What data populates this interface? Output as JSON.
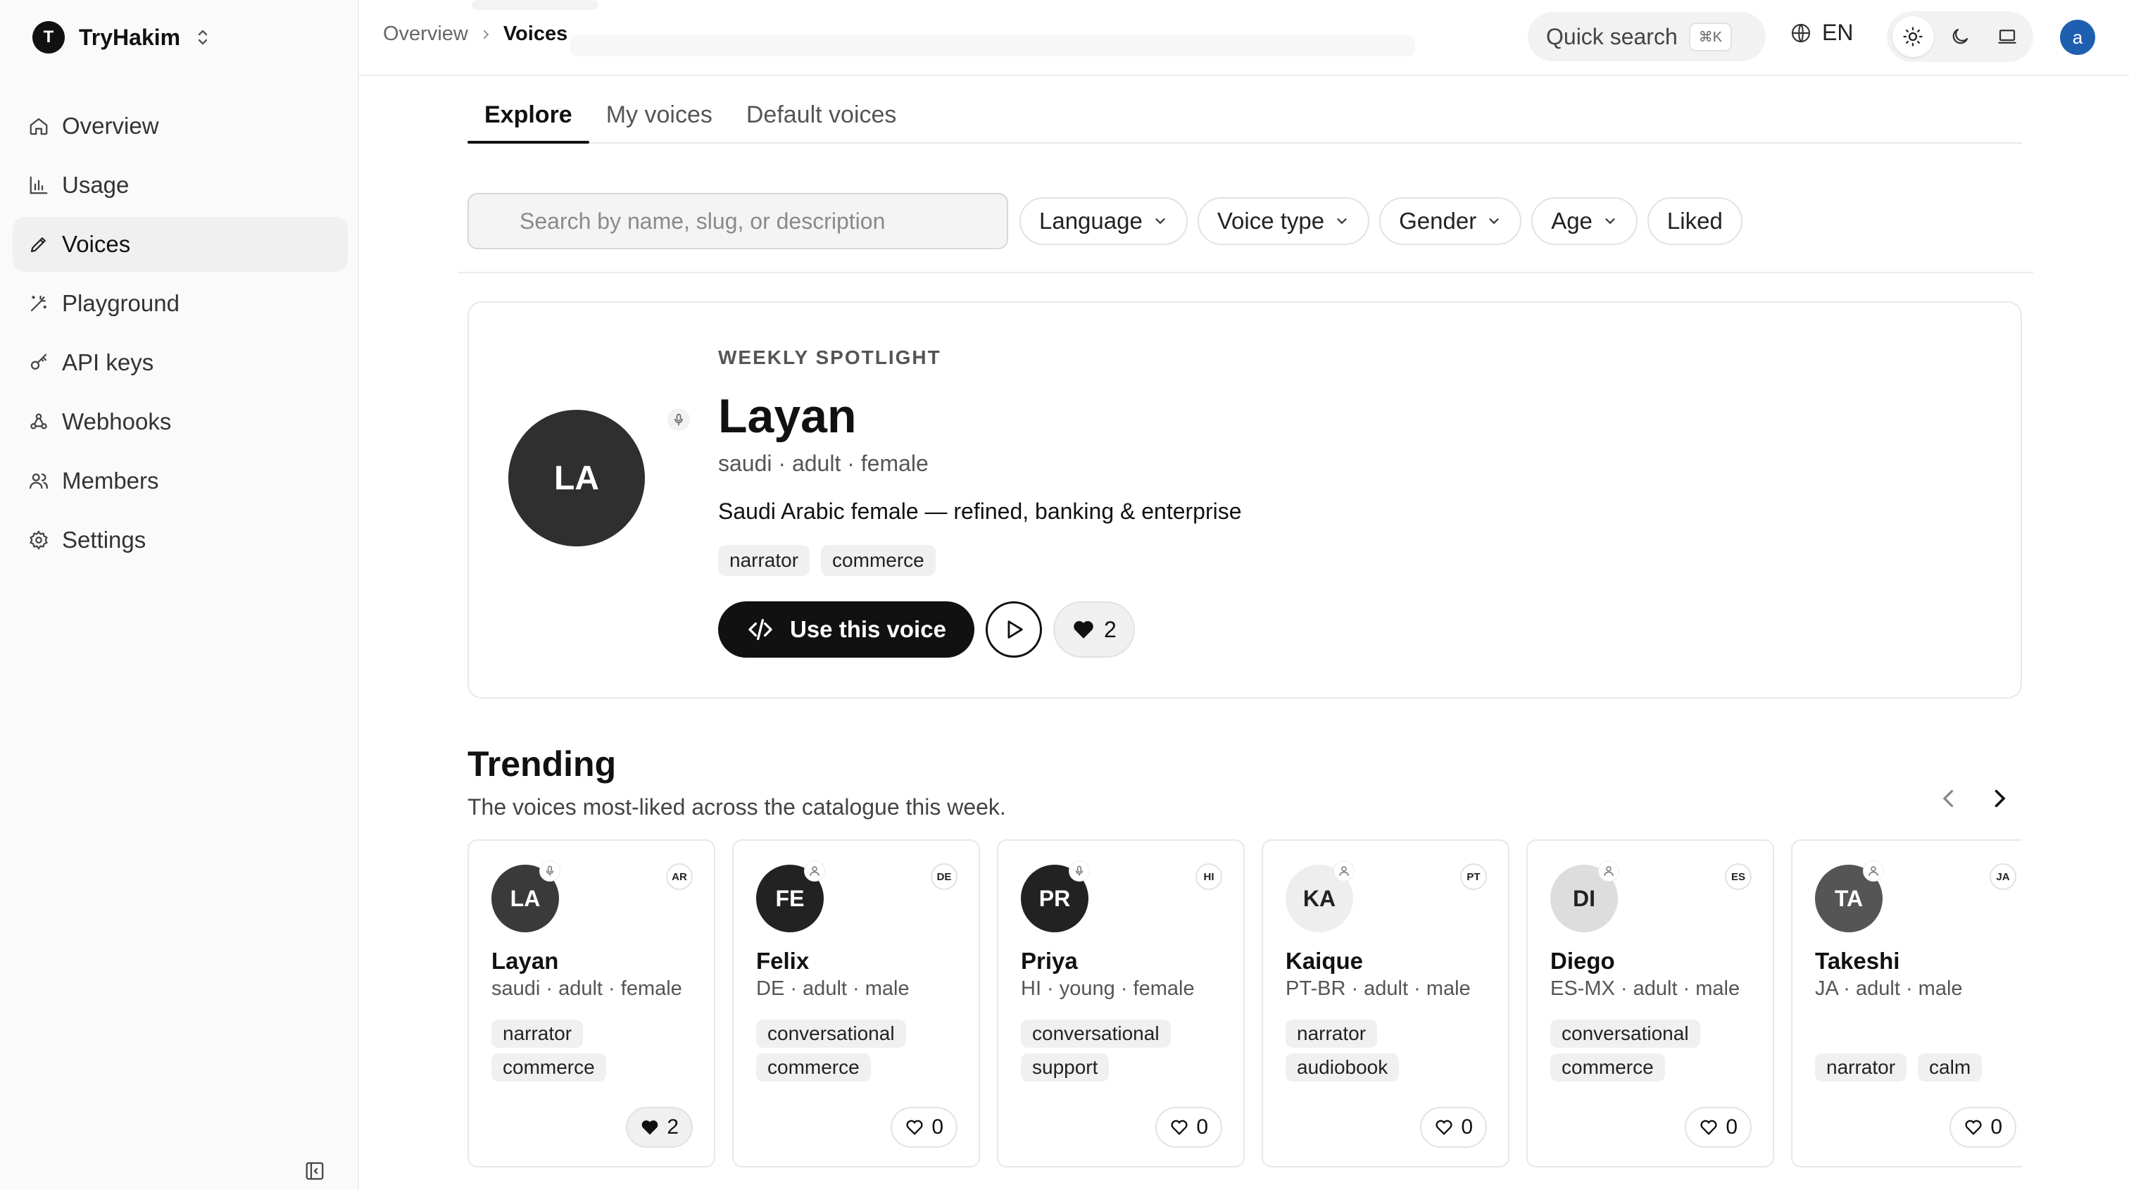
{
  "brand": {
    "initial": "T",
    "name": "TryHakim"
  },
  "nav": [
    {
      "label": "Overview",
      "icon": "home-icon"
    },
    {
      "label": "Usage",
      "icon": "bar-chart-icon"
    },
    {
      "label": "Voices",
      "icon": "pen-icon",
      "active": true
    },
    {
      "label": "Playground",
      "icon": "wand-icon"
    },
    {
      "label": "API keys",
      "icon": "key-icon"
    },
    {
      "label": "Webhooks",
      "icon": "webhook-icon"
    },
    {
      "label": "Members",
      "icon": "users-icon"
    },
    {
      "label": "Settings",
      "icon": "gear-icon"
    }
  ],
  "header": {
    "breadcrumb": {
      "parent": "Overview",
      "current": "Voices"
    },
    "quick_search": {
      "label": "Quick search",
      "shortcut": "⌘K"
    },
    "language": "EN",
    "user_initial": "a"
  },
  "tabs": [
    "Explore",
    "My voices",
    "Default voices"
  ],
  "search": {
    "placeholder": "Search by name, slug, or description"
  },
  "filters": [
    "Language",
    "Voice type",
    "Gender",
    "Age",
    "Liked"
  ],
  "spotlight": {
    "eyebrow": "WEEKLY SPOTLIGHT",
    "initials": "LA",
    "name": "Layan",
    "meta": "saudi · adult · female",
    "description": "Saudi Arabic female — refined, banking & enterprise",
    "tags": [
      "narrator",
      "commerce"
    ],
    "use_label": "Use this voice",
    "likes": "2"
  },
  "trending": {
    "title": "Trending",
    "subtitle": "The voices most-liked across the catalogue this week.",
    "cards": [
      {
        "initials": "LA",
        "name": "Layan",
        "lang": "AR",
        "meta": "saudi · adult · female",
        "tags": [
          "narrator",
          "commerce"
        ],
        "likes": "2",
        "liked": true,
        "badge": "mic-icon",
        "avatar_color": "#3a3a3a"
      },
      {
        "initials": "FE",
        "name": "Felix",
        "lang": "DE",
        "meta": "DE · adult · male",
        "tags": [
          "conversational",
          "commerce"
        ],
        "likes": "0",
        "liked": false,
        "badge": "person-icon",
        "avatar_color": "#222222"
      },
      {
        "initials": "PR",
        "name": "Priya",
        "lang": "HI",
        "meta": "HI · young · female",
        "tags": [
          "conversational",
          "support"
        ],
        "likes": "0",
        "liked": false,
        "badge": "mic-icon",
        "avatar_color": "#222222"
      },
      {
        "initials": "KA",
        "name": "Kaique",
        "lang": "PT",
        "meta": "PT-BR · adult · male",
        "tags": [
          "narrator",
          "audiobook"
        ],
        "likes": "0",
        "liked": false,
        "badge": "person-icon",
        "avatar_color": "#eeeeee"
      },
      {
        "initials": "DI",
        "name": "Diego",
        "lang": "ES",
        "meta": "ES-MX · adult · male",
        "tags": [
          "conversational",
          "commerce"
        ],
        "likes": "0",
        "liked": false,
        "badge": "person-icon",
        "avatar_color": "#dddddd"
      },
      {
        "initials": "TA",
        "name": "Takeshi",
        "lang": "JA",
        "meta": "JA · adult · male",
        "tags": [
          "narrator",
          "calm"
        ],
        "likes": "0",
        "liked": false,
        "badge": "person-icon",
        "avatar_color": "#555555"
      }
    ]
  }
}
